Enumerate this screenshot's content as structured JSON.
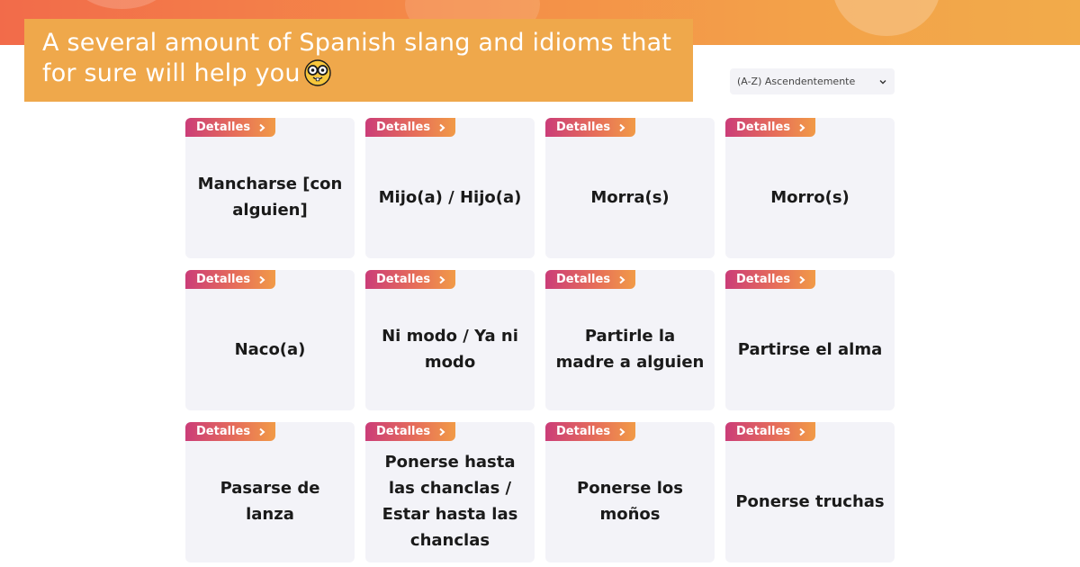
{
  "header": {
    "title": "A several amount of Spanish slang and idioms that for sure will help you",
    "title_icon": "nerd-face-icon"
  },
  "sort": {
    "selected": "(A-Z) Ascendentemente"
  },
  "colors": {
    "banner_bg": "#efa84b",
    "top_band_start": "#f26b4a",
    "top_band_end": "#f2ab4a",
    "tag_start": "#cb3d78",
    "tag_end": "#f19a47",
    "card_bg": "#f3f3f8"
  },
  "cards": [
    {
      "tag": "Detalles",
      "title": "Mancharse [con alguien]"
    },
    {
      "tag": "Detalles",
      "title": "Mijo(a) / Hijo(a)"
    },
    {
      "tag": "Detalles",
      "title": "Morra(s)"
    },
    {
      "tag": "Detalles",
      "title": "Morro(s)"
    },
    {
      "tag": "Detalles",
      "title": "Naco(a)"
    },
    {
      "tag": "Detalles",
      "title": "Ni modo / Ya ni modo"
    },
    {
      "tag": "Detalles",
      "title": "Partirle la madre a alguien"
    },
    {
      "tag": "Detalles",
      "title": "Partirse el alma"
    },
    {
      "tag": "Detalles",
      "title": "Pasarse de lanza"
    },
    {
      "tag": "Detalles",
      "title": "Ponerse hasta las chanclas / Estar hasta las chanclas"
    },
    {
      "tag": "Detalles",
      "title": "Ponerse los moños"
    },
    {
      "tag": "Detalles",
      "title": "Ponerse truchas"
    }
  ]
}
